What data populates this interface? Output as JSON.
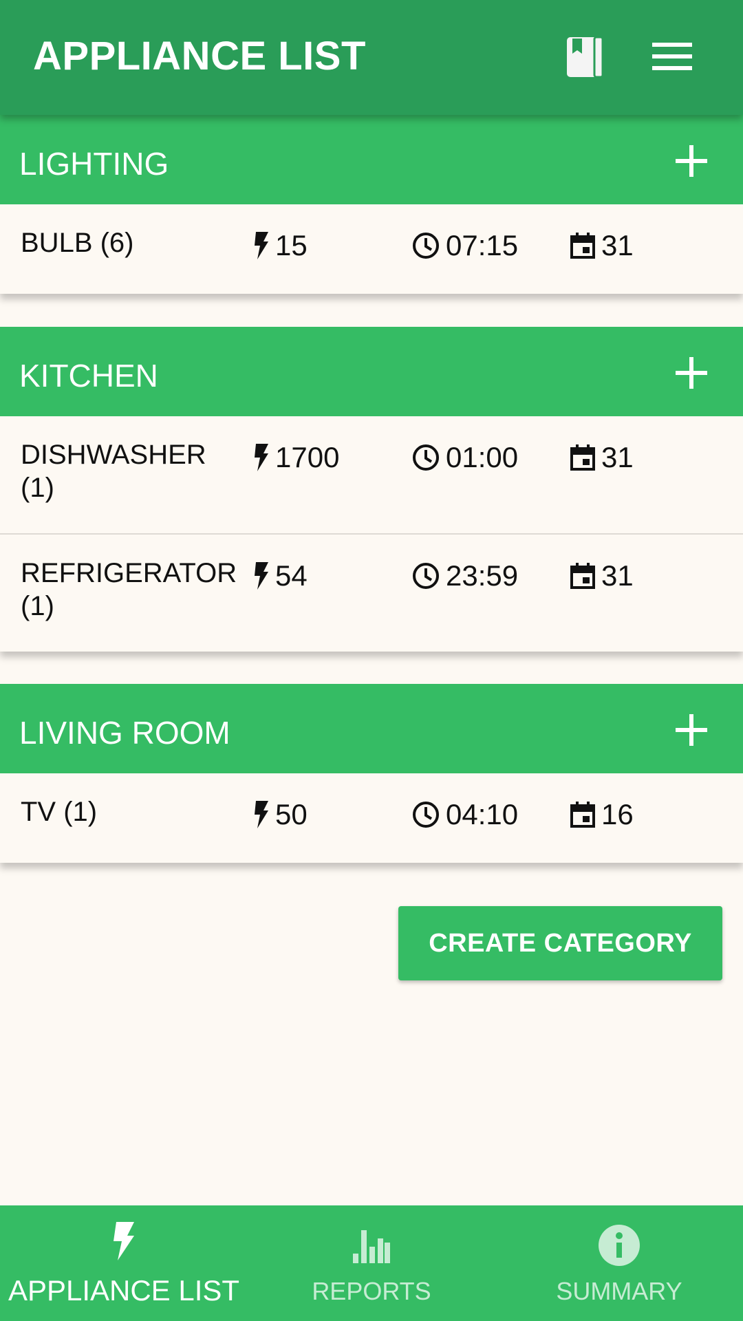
{
  "app_bar": {
    "title": "APPLIANCE LIST",
    "actions": [
      {
        "icon": "book-icon"
      },
      {
        "icon": "menu-icon"
      }
    ]
  },
  "categories": [
    {
      "name": "LIGHTING",
      "appliances": [
        {
          "name": "BULB (6)",
          "power": "15",
          "time": "07:15",
          "days": "31"
        }
      ]
    },
    {
      "name": "KITCHEN",
      "appliances": [
        {
          "name": "DISHWASHER (1)",
          "power": "1700",
          "time": "01:00",
          "days": "31"
        },
        {
          "name": "REFRIGERATOR (1)",
          "power": "54",
          "time": "23:59",
          "days": "31"
        }
      ]
    },
    {
      "name": "LIVING ROOM",
      "appliances": [
        {
          "name": "TV (1)",
          "power": "50",
          "time": "04:10",
          "days": "16"
        }
      ]
    }
  ],
  "create_category_label": "CREATE CATEGORY",
  "bottom_nav": [
    {
      "label": "APPLIANCE LIST",
      "icon": "bolt-icon",
      "active": true
    },
    {
      "label": "REPORTS",
      "icon": "bar-chart-icon",
      "active": false
    },
    {
      "label": "SUMMARY",
      "icon": "info-icon",
      "active": false
    }
  ],
  "colors": {
    "app_bar": "#2a9d58",
    "accent": "#35bc64",
    "background": "#fdf9f3",
    "inactive_nav": "#c6ecd3"
  }
}
